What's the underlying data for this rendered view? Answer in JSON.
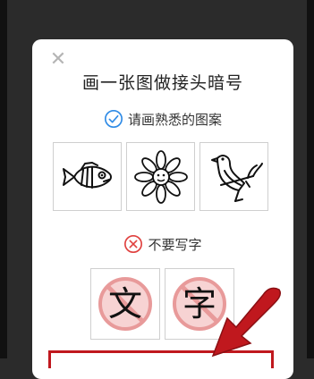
{
  "dialog": {
    "close_icon": "close-icon",
    "title": "画一张图做接头暗号"
  },
  "do_section": {
    "icon": "check-circle-icon",
    "label": "请画熟悉的图案",
    "color": "#2f8be6",
    "examples": [
      {
        "name": "fish-drawing",
        "icon": "fish-icon"
      },
      {
        "name": "flower-drawing",
        "icon": "flower-icon"
      },
      {
        "name": "bird-drawing",
        "icon": "bird-icon"
      }
    ]
  },
  "dont_section": {
    "icon": "cross-circle-icon",
    "label": "不要写字",
    "color": "#e0413f",
    "examples": [
      {
        "name": "char-wen",
        "text": "文"
      },
      {
        "name": "char-zi",
        "text": "字"
      }
    ]
  },
  "annotation": {
    "arrow_color": "#c0181e"
  }
}
